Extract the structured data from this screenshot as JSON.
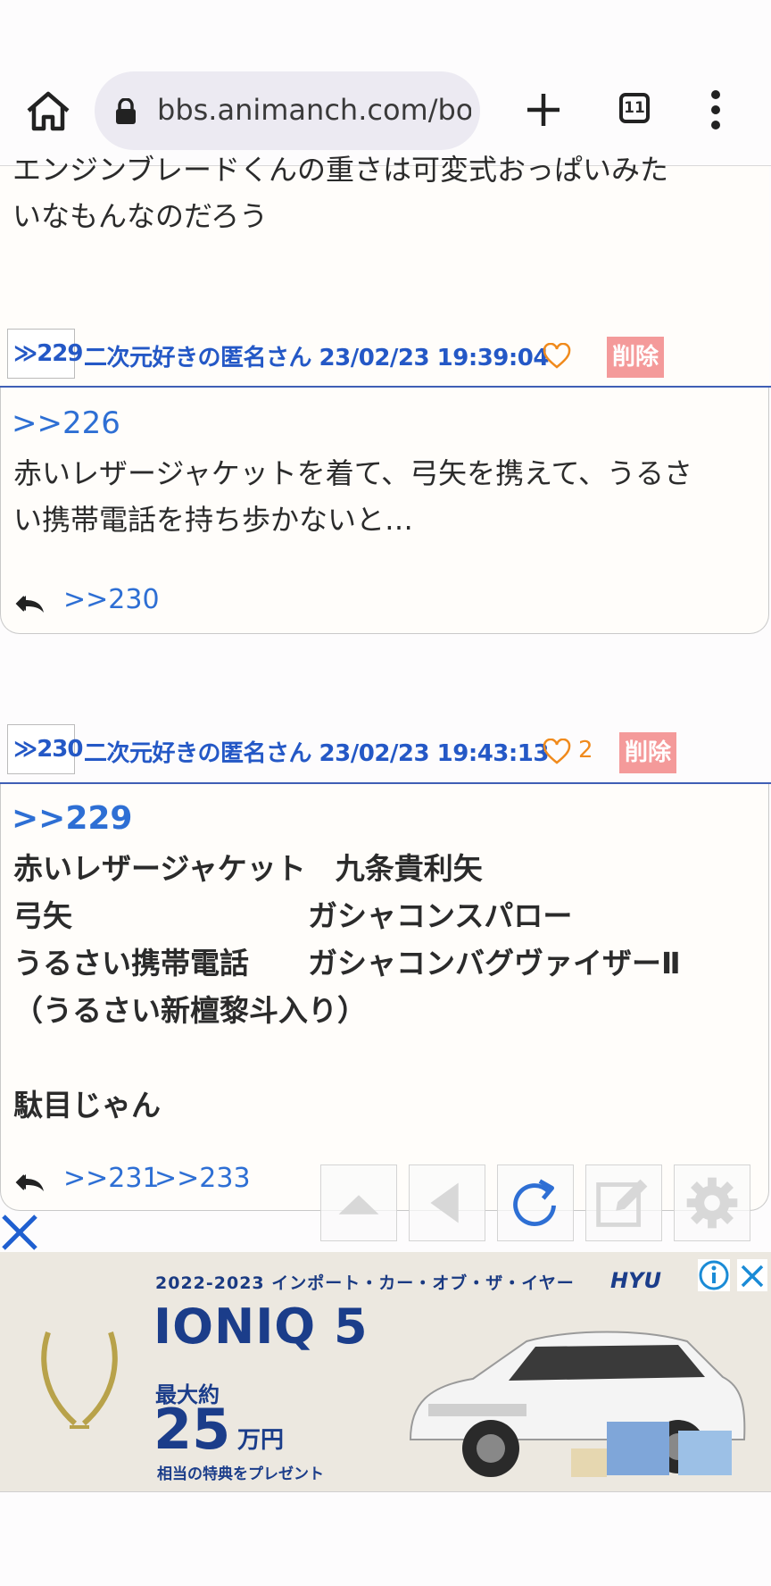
{
  "browser": {
    "url_display": "bbs.animanch.com/bo",
    "tab_count": "11"
  },
  "posts": {
    "p228": {
      "text_partial": "エンジンブレードくんの重さは可変式おっぱいみた\nいなもんなのだろう"
    },
    "p229": {
      "number": "≫229",
      "poster": "二次元好きの匿名さん 23/02/23 19:39:04",
      "likes": "",
      "delete_label": "削除",
      "anchor": ">>226",
      "text": "赤いレザージャケットを着て、弓矢を携えて、うるさ\nい携帯電話を持ち歩かないと…",
      "replies": [
        ">>230"
      ]
    },
    "p230": {
      "number": "≫230",
      "poster": "二次元好きの匿名さん 23/02/23 19:43:13",
      "likes": "2",
      "delete_label": "削除",
      "anchor": ">>229",
      "text": "赤いレザージャケット　九条貴利矢\n弓矢　　　　　　　　ガシャコンスパロー\nうるさい携帯電話　　ガシャコンバグヴァイザーⅡ\n（うるさい新檀黎斗入り）\n\n駄目じゃん",
      "replies": [
        ">>231",
        ">>233"
      ]
    }
  },
  "toolbar": {
    "icons": [
      "scroll-up-icon",
      "back-icon",
      "reload-icon",
      "edit-icon",
      "settings-icon"
    ]
  },
  "ad": {
    "headline": "2022-2023 インポート・カー・オブ・ザ・イヤー",
    "title": "IONIQ 5",
    "line1": "最大約",
    "amount": "25",
    "unit": "万円",
    "sub": "相当の特典をプレゼント",
    "brand": "HYU"
  },
  "colors": {
    "link": "#2e6fd4",
    "poster": "#2458c6",
    "like": "#f08a1c",
    "delete": "#f49a9a",
    "header_line": "#3f5fb5"
  }
}
